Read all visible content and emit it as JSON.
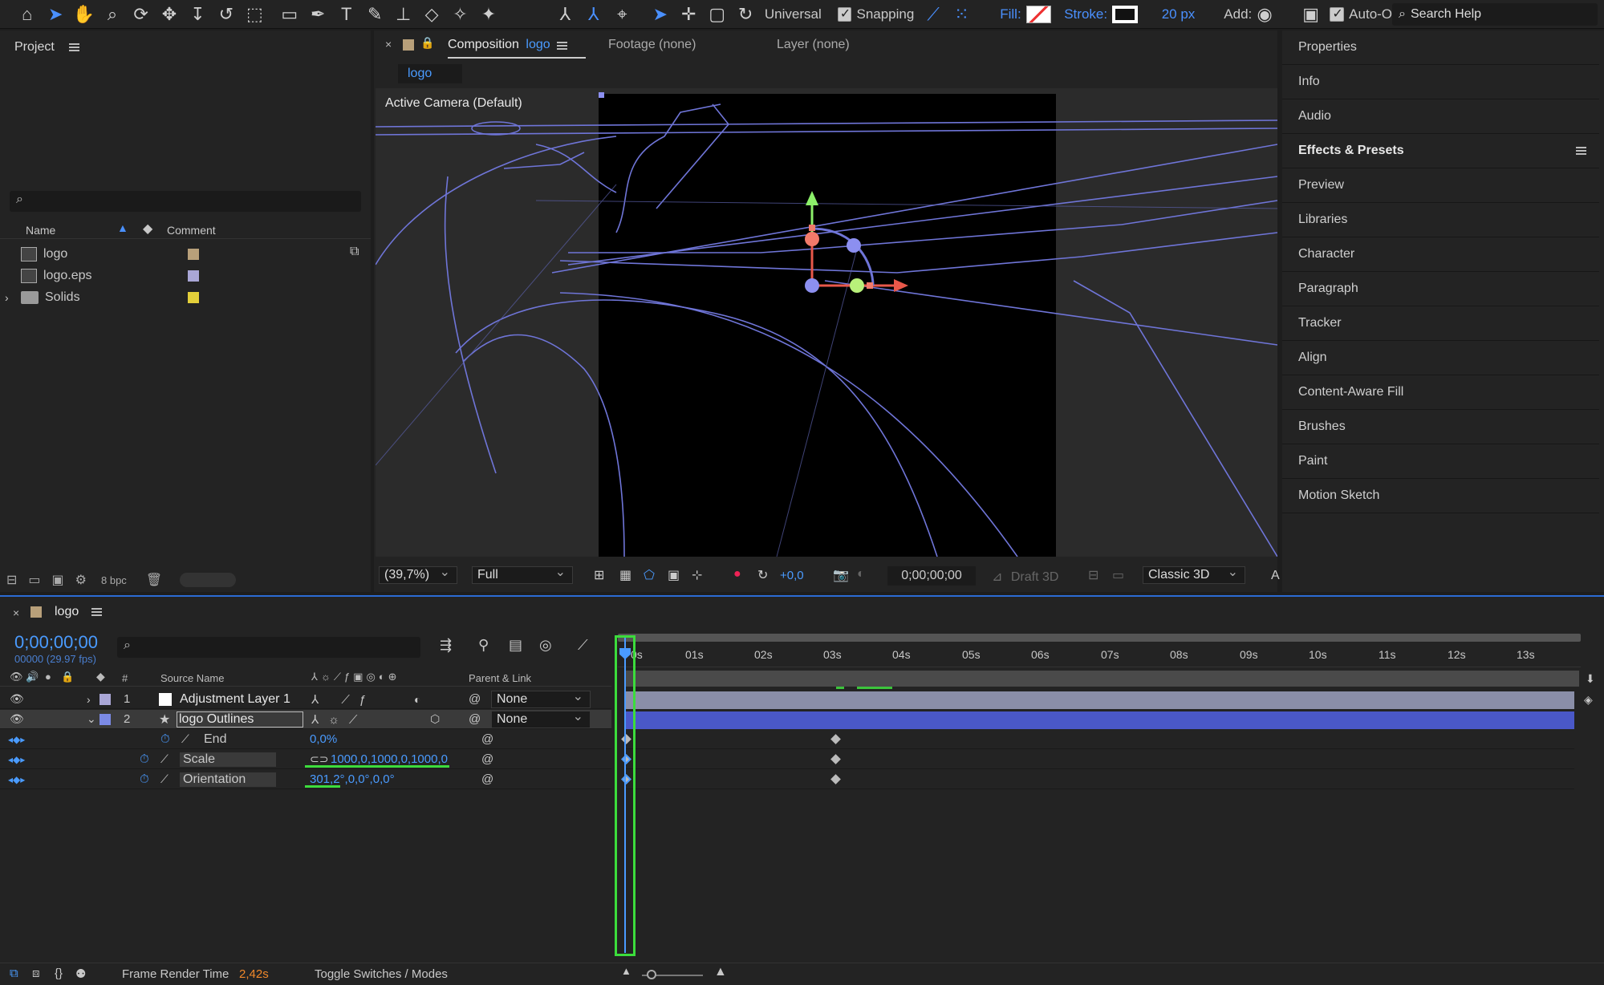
{
  "toolbar": {
    "universal_label": "Universal",
    "snapping_label": "Snapping",
    "fill_label": "Fill:",
    "stroke_label": "Stroke:",
    "stroke_width": "20 px",
    "add_label": "Add:",
    "auto_label": "Auto-O",
    "search_placeholder": "Search Help"
  },
  "project": {
    "title": "Project",
    "col_name": "Name",
    "col_comment": "Comment",
    "items": [
      {
        "name": "logo",
        "color": "#b8a07a"
      },
      {
        "name": "logo.eps",
        "color": "#a9a6d6"
      },
      {
        "name": "Solids",
        "color": "#e3cf3a"
      }
    ],
    "bpc": "8 bpc"
  },
  "comp": {
    "tab_prefix": "Composition",
    "tab_name": "logo",
    "footage_tab": "Footage (none)",
    "layer_tab": "Layer (none)",
    "subtab": "logo",
    "camera_label": "Active Camera (Default)",
    "zoom": "(39,7%)",
    "resolution": "Full",
    "exposure": "+0,0",
    "timecode": "0;00;00;00",
    "draft3d": "Draft 3D",
    "renderer": "Classic 3D",
    "more": "A"
  },
  "right_panel": {
    "items": [
      "Properties",
      "Info",
      "Audio",
      "Effects & Presets",
      "Preview",
      "Libraries",
      "Character",
      "Paragraph",
      "Tracker",
      "Align",
      "Content-Aware Fill",
      "Brushes",
      "Paint",
      "Motion Sketch"
    ]
  },
  "timeline": {
    "comp_name": "logo",
    "timecode": "0;00;00;00",
    "frames": "00000 (29.97 fps)",
    "col_hash": "#",
    "col_source": "Source Name",
    "col_parent": "Parent & Link",
    "ticks": [
      "0s",
      "01s",
      "02s",
      "03s",
      "04s",
      "05s",
      "06s",
      "07s",
      "08s",
      "09s",
      "10s",
      "11s",
      "12s",
      "13s"
    ],
    "layers": [
      {
        "num": "1",
        "name": "Adjustment Layer 1",
        "label_color": "#a9a6d6",
        "parent": "None"
      },
      {
        "num": "2",
        "name": "logo Outlines",
        "label_color": "#7b8ae6",
        "parent": "None"
      }
    ],
    "props": [
      {
        "name": "End",
        "value": "0,0%"
      },
      {
        "name": "Scale",
        "value": "1000,0,1000,0,1000,0"
      },
      {
        "name": "Orientation",
        "value": "301,2°,0,0°,0,0°"
      }
    ],
    "render_label": "Frame Render Time",
    "render_value": "2,42s",
    "toggle_label": "Toggle Switches / Modes"
  }
}
